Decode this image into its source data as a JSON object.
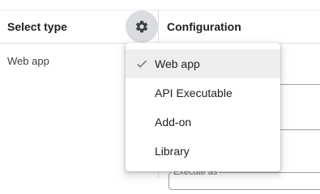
{
  "header": {
    "left_title": "Select type",
    "right_title": "Configuration",
    "settings_icon": "gear-icon"
  },
  "left_list": {
    "items": [
      {
        "label": "Web app"
      }
    ]
  },
  "background_form": {
    "execute_as_label": "Execute as"
  },
  "type_menu": {
    "items": [
      {
        "label": "Web app",
        "selected": true
      },
      {
        "label": "API Executable",
        "selected": false
      },
      {
        "label": "Add-on",
        "selected": false
      },
      {
        "label": "Library",
        "selected": false
      }
    ],
    "check_icon": "check-icon"
  }
}
